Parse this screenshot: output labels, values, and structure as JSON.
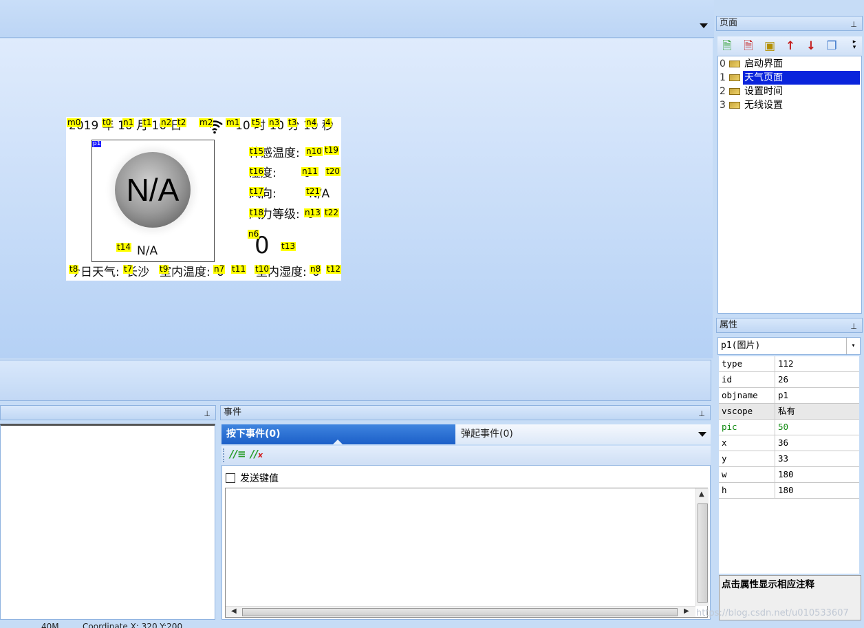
{
  "screen": {
    "date_text": "2019 年 10 月 10 日",
    "time_text": "10 时 10 分 10 秒",
    "picture_text": "N/A",
    "weather_caption": "N/A",
    "feels_like_label": "体感温度:",
    "feels_like_value": "0",
    "humidity_label": "湿度:",
    "humidity_value": "0",
    "wind_dir_label": "风向:",
    "wind_dir_value": "N/A",
    "wind_level_label": "风力等级:",
    "wind_level_value": "0",
    "big_number": "0",
    "bottom_weather_label": "今日天气:",
    "city": "长沙",
    "indoor_temp_label": "室内温度:",
    "indoor_temp_value": "0",
    "indoor_hum_label": "室内湿度:",
    "indoor_hum_value": "0",
    "tags": {
      "m0": "m0",
      "t0": "t0",
      "n1": "n1",
      "t1": "t1",
      "n2": "n2",
      "t2": "t2",
      "m2": "m2",
      "m1": "m1",
      "t5": "t5",
      "n3": "n3",
      "t3": "t3",
      "n4": "n4",
      "t4": "4",
      "p1": "p1",
      "t15": "t15",
      "n10": "n10",
      "t19": "t19",
      "t16": "t16",
      "n11": "n11",
      "t20": "t20",
      "t17": "t17",
      "t21": "t21",
      "t18": "t18",
      "n13": "n13",
      "t22": "t22",
      "n6": "n6",
      "t13": "t13",
      "t14": "t14",
      "t8": "t8",
      "t7": "t7",
      "t9": "t9",
      "n7": "n7",
      "t11": "t11",
      "t10": "t10",
      "n8": "n8",
      "t12": "t12"
    }
  },
  "pages_panel": {
    "title": "页面",
    "items": [
      {
        "index": "0",
        "label": "启动界面"
      },
      {
        "index": "1",
        "label": "天气页面"
      },
      {
        "index": "2",
        "label": "设置时间"
      },
      {
        "index": "3",
        "label": "无线设置"
      }
    ],
    "selected_index": 1,
    "tool_icons": [
      "add-page-icon",
      "delete-page-icon",
      "import-page-icon",
      "move-up-icon",
      "move-down-icon",
      "copy-page-icon"
    ]
  },
  "props_panel": {
    "title": "属性",
    "selected_object": "p1(图片)",
    "rows": [
      {
        "key": "type",
        "value": "112"
      },
      {
        "key": "id",
        "value": "26"
      },
      {
        "key": "objname",
        "value": "p1"
      },
      {
        "key": "vscope",
        "value": "私有"
      },
      {
        "key": "pic",
        "value": "50"
      },
      {
        "key": "x",
        "value": "36"
      },
      {
        "key": "y",
        "value": "33"
      },
      {
        "key": "w",
        "value": "180"
      },
      {
        "key": "h",
        "value": "180"
      }
    ],
    "note": "点击属性显示相应注释"
  },
  "events_panel": {
    "title": "事件",
    "tab_press": "按下事件(0)",
    "tab_release": "弹起事件(0)",
    "send_key_label": "发送键值"
  },
  "status": {
    "memory": "40M",
    "coordinate": "Coordinate X: 320  Y:200"
  },
  "watermark": "https://blog.csdn.net/u010533607",
  "colors": {
    "selection": "#0a24dc",
    "tag_yellow": "#ffff00",
    "tab_active": "#1c5fc8",
    "pic_property": "#118a11"
  }
}
